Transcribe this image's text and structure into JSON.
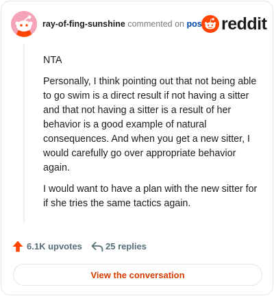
{
  "comment": {
    "author": "ray-of-fing-sunshine",
    "connector": "commented on",
    "post_link": "post",
    "paragraphs": [
      "NTA",
      "Personally, I think pointing out that not being able to go swim is a direct result if not having a sitter and that not having a sitter is a result of her behavior is a good example of natural consequences. And when you get a new sitter, I would carefully go over appropriate behavior again.",
      "I would want to have a plan with the new sitter for if she tries the same tactics again."
    ]
  },
  "brand": {
    "wordmark": "reddit"
  },
  "actions": {
    "upvotes": "6.1K upvotes",
    "replies": "25 replies"
  },
  "cta": {
    "label": "View the conversation"
  },
  "colors": {
    "accent": "#ff4500",
    "link": "#0045ac",
    "muted": "#576f76",
    "avatar_bg": "#f5a3b8"
  },
  "icons": {
    "avatar": "snoo-avatar-icon",
    "brand": "reddit-logo-icon",
    "upvote": "upvote-arrow-icon",
    "reply": "reply-arrow-icon"
  }
}
